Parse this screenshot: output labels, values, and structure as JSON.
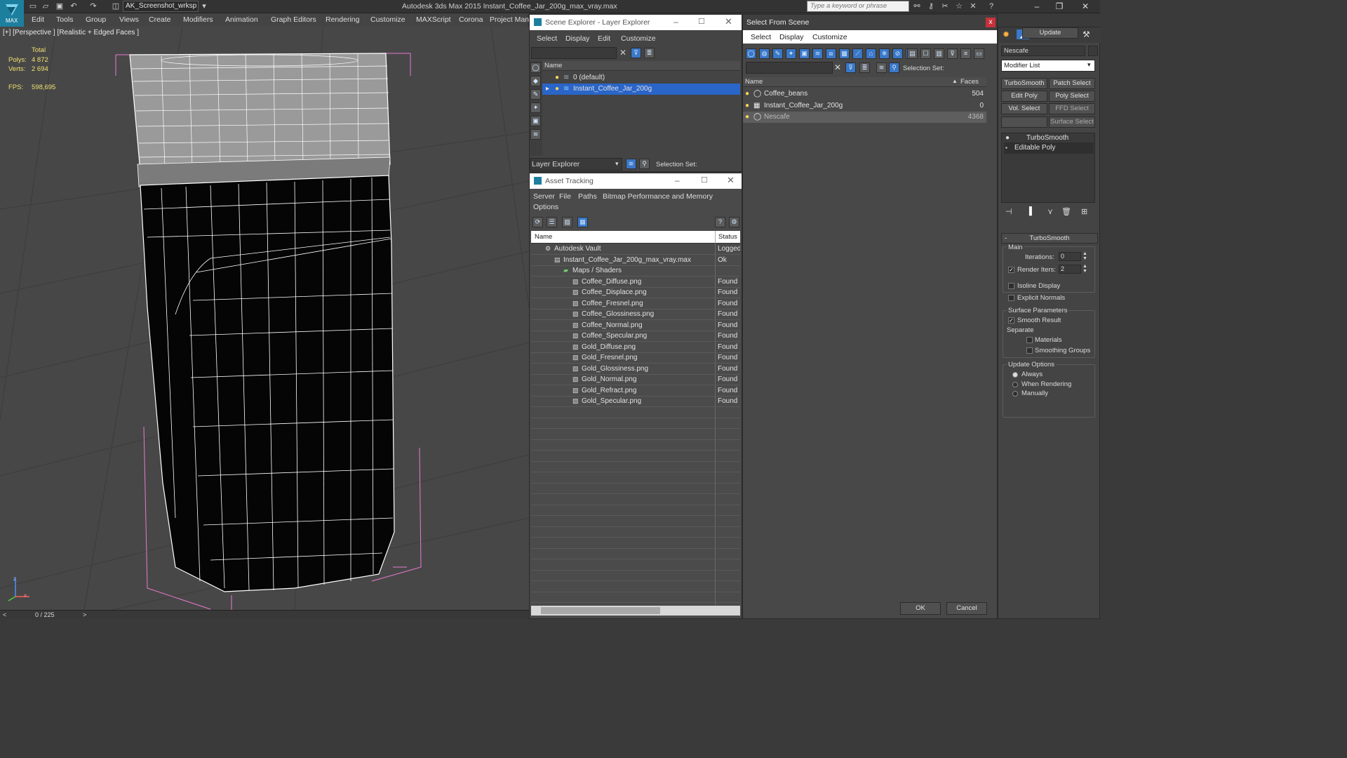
{
  "app": {
    "title": "Autodesk 3ds Max  2015     Instant_Coffee_Jar_200g_max_vray.max",
    "workspace": "AK_Screenshot_wrksp",
    "search_placeholder": "Type a keyword or phrase",
    "logo_label": "MAX"
  },
  "menubar": [
    "Edit",
    "Tools",
    "Group",
    "Views",
    "Create",
    "Modifiers",
    "Animation",
    "Graph Editors",
    "Rendering",
    "Customize",
    "MAXScript",
    "Corona",
    "Project Man"
  ],
  "viewport": {
    "label": "[+] [Perspective ] [Realistic + Edged Faces ]",
    "stats": {
      "total_label": "Total",
      "polys_label": "Polys:",
      "polys": "4 872",
      "verts_label": "Verts:",
      "verts": "2 694",
      "fps_label": "FPS:",
      "fps": "598,695"
    },
    "timeline": "0 / 225",
    "axis": {
      "z": "z",
      "x": "x"
    }
  },
  "scene_explorer": {
    "title": "Scene Explorer - Layer Explorer",
    "menu": [
      "Select",
      "Display",
      "Edit",
      "Customize"
    ],
    "col_name": "Name",
    "layers": [
      {
        "name": "0 (default)"
      },
      {
        "name": "Instant_Coffee_Jar_200g"
      }
    ],
    "mode": "Layer Explorer",
    "selection_set": "Selection Set:"
  },
  "asset_tracking": {
    "title": "Asset Tracking",
    "menu": [
      "Server",
      "File",
      "Paths",
      "Bitmap Performance and Memory"
    ],
    "menu2": "Options",
    "col_name": "Name",
    "col_status": "Status",
    "rows": [
      {
        "name": "Autodesk Vault",
        "status": "Logged",
        "indent": 0
      },
      {
        "name": "Instant_Coffee_Jar_200g_max_vray.max",
        "status": "Ok",
        "indent": 1
      },
      {
        "name": "Maps / Shaders",
        "status": "",
        "indent": 2
      },
      {
        "name": "Coffee_Diffuse.png",
        "status": "Found",
        "indent": 3
      },
      {
        "name": "Coffee_Displace.png",
        "status": "Found",
        "indent": 3
      },
      {
        "name": "Coffee_Fresnel.png",
        "status": "Found",
        "indent": 3
      },
      {
        "name": "Coffee_Glossiness.png",
        "status": "Found",
        "indent": 3
      },
      {
        "name": "Coffee_Normal.png",
        "status": "Found",
        "indent": 3
      },
      {
        "name": "Coffee_Specular.png",
        "status": "Found",
        "indent": 3
      },
      {
        "name": "Gold_Diffuse.png",
        "status": "Found",
        "indent": 3
      },
      {
        "name": "Gold_Fresnel.png",
        "status": "Found",
        "indent": 3
      },
      {
        "name": "Gold_Glossiness.png",
        "status": "Found",
        "indent": 3
      },
      {
        "name": "Gold_Normal.png",
        "status": "Found",
        "indent": 3
      },
      {
        "name": "Gold_Refract.png",
        "status": "Found",
        "indent": 3
      },
      {
        "name": "Gold_Specular.png",
        "status": "Found",
        "indent": 3
      }
    ]
  },
  "select_from_scene": {
    "title": "Select From Scene",
    "menu": [
      "Select",
      "Display",
      "Customize"
    ],
    "selection_set": "Selection Set:",
    "col_name": "Name",
    "col_faces": "Faces",
    "rows": [
      {
        "name": "Coffee_beans",
        "faces": "504"
      },
      {
        "name": "Instant_Coffee_Jar_200g",
        "faces": "0"
      },
      {
        "name": "Nescafe",
        "faces": "4368"
      }
    ],
    "ok": "OK",
    "cancel": "Cancel"
  },
  "command_panel": {
    "object_name": "Nescafe",
    "modifier_list": "Modifier List",
    "mod_buttons": [
      "TurboSmooth",
      "Patch Select",
      "Edit Poly",
      "Poly Select",
      "Vol. Select",
      "FFD Select",
      "Surface Select"
    ],
    "stack": [
      "TurboSmooth",
      "Editable Poly"
    ],
    "rollout": "TurboSmooth",
    "main": "Main",
    "iterations_label": "Iterations:",
    "iterations": "0",
    "render_iters_label": "Render Iters:",
    "render_iters": "2",
    "isoline": "Isoline Display",
    "explicit": "Explicit Normals",
    "surface_params": "Surface Parameters",
    "smooth_result": "Smooth Result",
    "separate": "Separate",
    "materials": "Materials",
    "smoothing_groups": "Smoothing Groups",
    "update_options": "Update Options",
    "always": "Always",
    "when_rendering": "When Rendering",
    "manually": "Manually",
    "update": "Update"
  },
  "colors": {
    "accent": "#2a65c8",
    "selection": "#5a5a5a",
    "stat": "#f0e070"
  }
}
